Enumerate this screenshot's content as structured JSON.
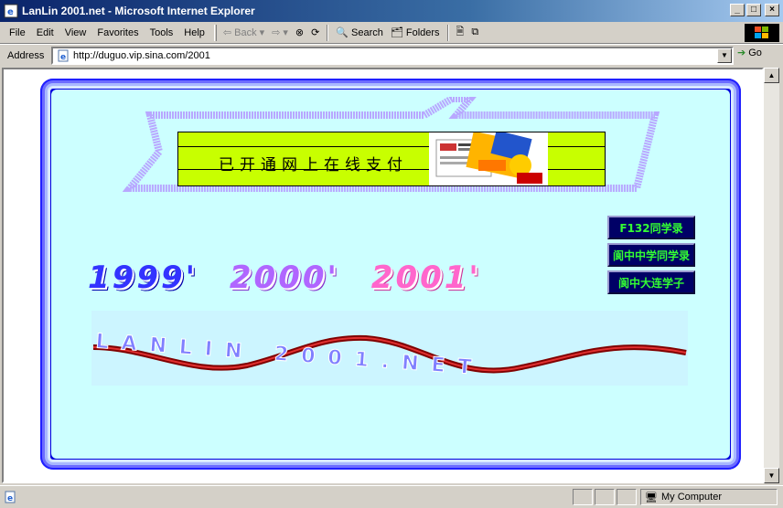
{
  "window": {
    "title": "LanLin 2001.net - Microsoft Internet Explorer"
  },
  "menu": {
    "items": [
      "File",
      "Edit",
      "View",
      "Favorites",
      "Tools",
      "Help"
    ]
  },
  "toolbar": {
    "back": "Back",
    "search": "Search",
    "folders": "Folders"
  },
  "address": {
    "label": "Address",
    "url": "http://duguo.vip.sina.com/2001",
    "go": "Go"
  },
  "page": {
    "banner_text": "已开通网上在线支付",
    "links": [
      "F132同学录",
      "阆中中学同学录",
      "阆中大连学子"
    ],
    "years": [
      "1999'",
      "2000'",
      "2001'"
    ],
    "wave_text": "LANLIN 2001.NET"
  },
  "status": {
    "zone": "My Computer"
  },
  "colors": {
    "page_bg": "#ccffff",
    "frame": "#0000dd",
    "banner": "#c8ff00",
    "link_text": "#33ff33",
    "link_bg": "#000066"
  }
}
